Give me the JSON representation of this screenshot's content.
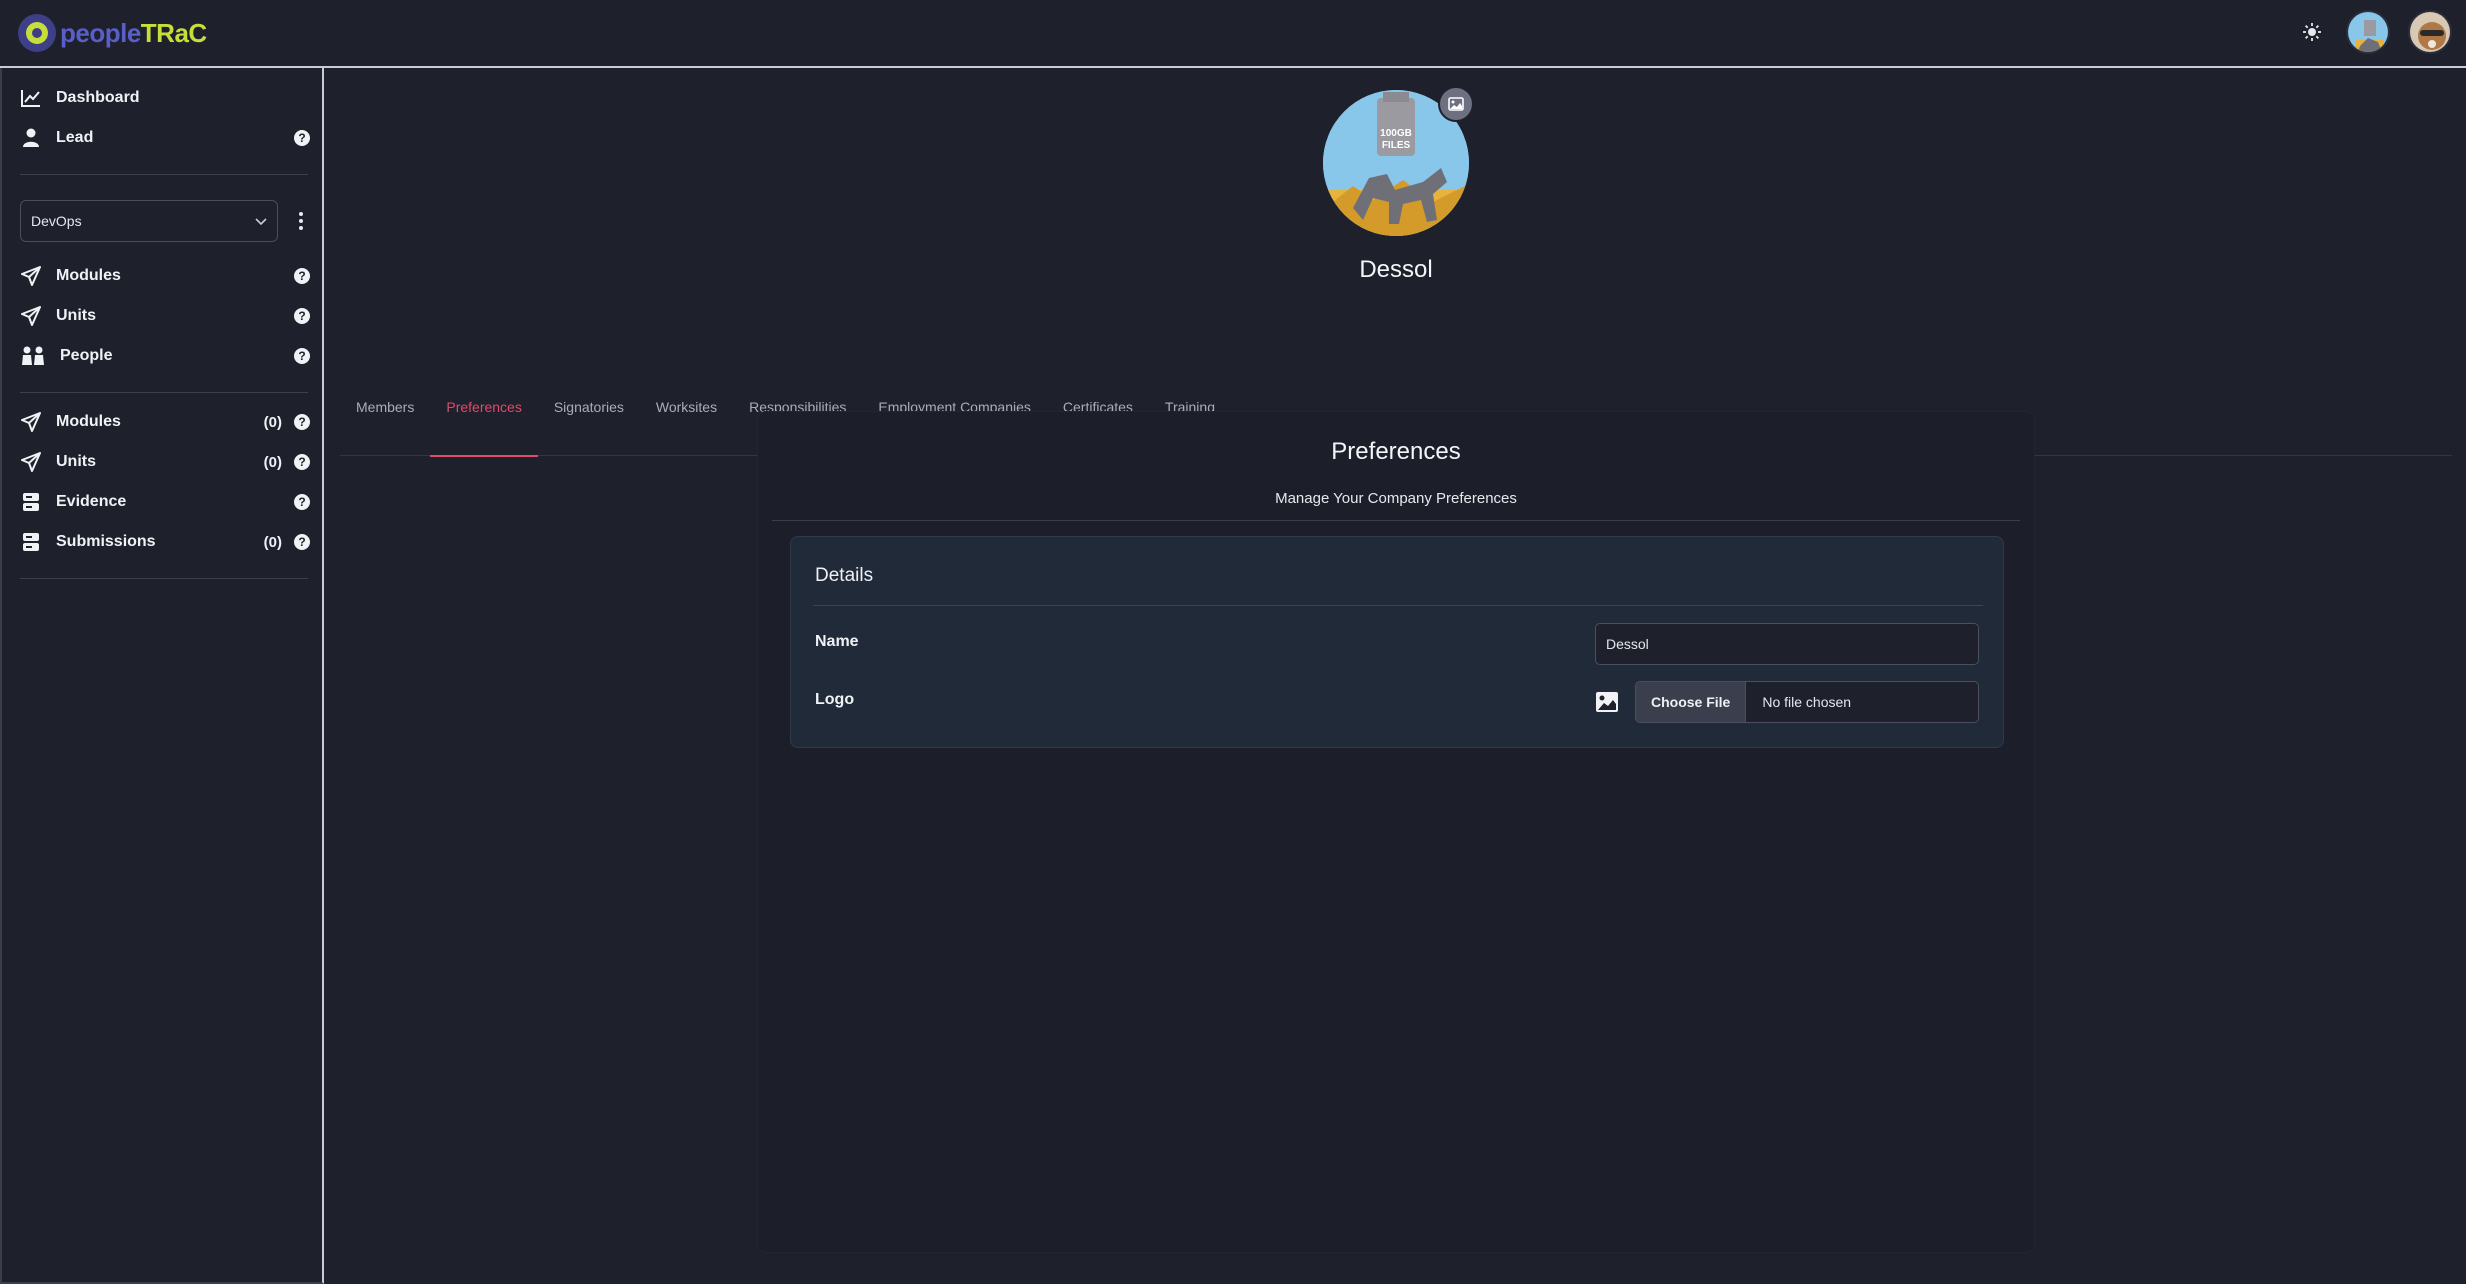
{
  "header": {
    "logo_text_a": "people",
    "logo_text_b": "TRaC"
  },
  "sidebar": {
    "top_items": [
      {
        "label": "Dashboard",
        "icon": "chart-line-icon"
      },
      {
        "label": "Lead",
        "icon": "user-icon",
        "help": "?"
      }
    ],
    "select": {
      "value": "DevOps"
    },
    "group1": [
      {
        "label": "Modules",
        "icon": "send-icon",
        "help": "?"
      },
      {
        "label": "Units",
        "icon": "send-icon",
        "help": "?"
      },
      {
        "label": "People",
        "icon": "people-icon",
        "help": "?"
      }
    ],
    "group2": [
      {
        "label": "Modules",
        "count": "(0)",
        "icon": "send-icon",
        "help": "?"
      },
      {
        "label": "Units",
        "count": "(0)",
        "icon": "send-icon",
        "help": "?"
      },
      {
        "label": "Evidence",
        "icon": "server-icon",
        "help": "?"
      },
      {
        "label": "Submissions",
        "count": "(0)",
        "icon": "server-icon",
        "help": "?"
      }
    ]
  },
  "company": {
    "name": "Dessol",
    "avatar_text": "100GB FILES"
  },
  "tabs": [
    {
      "label": "Members"
    },
    {
      "label": "Preferences",
      "active": true
    },
    {
      "label": "Signatories"
    },
    {
      "label": "Worksites"
    },
    {
      "label": "Responsibilities"
    },
    {
      "label": "Employment Companies"
    },
    {
      "label": "Certificates"
    },
    {
      "label": "Training"
    }
  ],
  "panel": {
    "title": "Preferences",
    "subtitle": "Manage Your Company Preferences",
    "card": {
      "title": "Details",
      "name_label": "Name",
      "name_value": "Dessol",
      "logo_label": "Logo",
      "file_button": "Choose File",
      "file_status": "No file chosen"
    }
  },
  "colors": {
    "accent": "#e04a6a",
    "background": "#1e202b",
    "card": "#202a39",
    "logo_blue": "#3e3f86",
    "logo_green": "#c6de3a"
  }
}
